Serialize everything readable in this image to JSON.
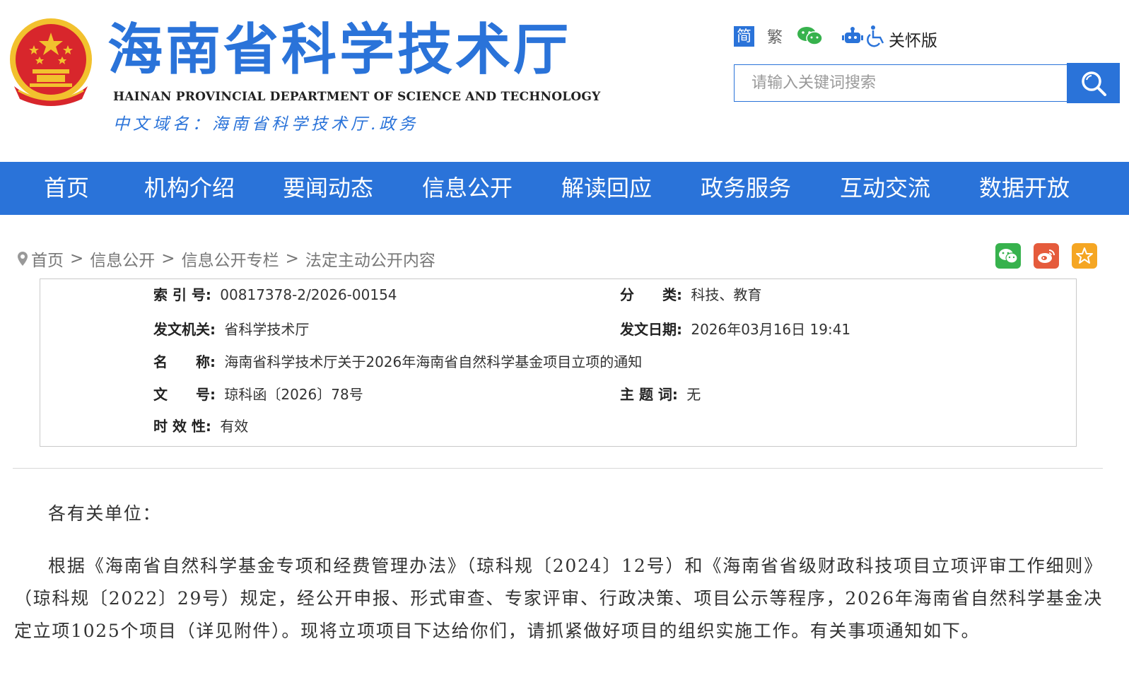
{
  "header": {
    "title": "海南省科学技术厅",
    "title_en": "HAINAN PROVINCIAL DEPARTMENT OF SCIENCE AND TECHNOLOGY",
    "domain": "中文域名：海南省科学技术厅.政务",
    "emblem_icon": "national-emblem-icon"
  },
  "tools": {
    "lang_simple": "简",
    "lang_traditional": "繁",
    "wechat_icon": "wechat-icon",
    "robot_icon": "robot-icon",
    "accessibility_icon": "wheelchair-icon",
    "care_label": "关怀版"
  },
  "search": {
    "placeholder": "请输入关键词搜索",
    "button_icon": "search-icon"
  },
  "nav": {
    "items": [
      {
        "label": "首页"
      },
      {
        "label": "机构介绍"
      },
      {
        "label": "要闻动态"
      },
      {
        "label": "信息公开"
      },
      {
        "label": "解读回应"
      },
      {
        "label": "政务服务"
      },
      {
        "label": "互动交流"
      },
      {
        "label": "数据开放"
      }
    ]
  },
  "breadcrumb": {
    "icon": "location-pin-icon",
    "items": [
      "首页",
      "信息公开",
      "信息公开专栏",
      "法定主动公开内容"
    ],
    "separator": ">"
  },
  "share": {
    "wechat": "wechat-share-icon",
    "weibo": "weibo-share-icon",
    "favorite": "star-favorite-icon"
  },
  "info": {
    "index_label": "索 引 号:",
    "index_value": "00817378-2/2026-00154",
    "category_label": "分　　类:",
    "category_value": "科技、教育",
    "issuer_label": "发文机关:",
    "issuer_value": "省科学技术厅",
    "date_label": "发文日期:",
    "date_value": "2026年03月16日 19:41",
    "name_label": "名　　称:",
    "name_value": "海南省科学技术厅关于2026年海南省自然科学基金项目立项的通知",
    "docno_label": "文　　号:",
    "docno_value": "琼科函〔2026〕78号",
    "keywords_label": "主 题 词:",
    "keywords_value": "无",
    "validity_label": "时 效 性:",
    "validity_value": "有效"
  },
  "content": {
    "greeting": "各有关单位：",
    "paragraph1": "根据《海南省自然科学基金专项和经费管理办法》（琼科规〔2024〕12号）和《海南省省级财政科技项目立项评审工作细则》（琼科规〔2022〕29号）规定，经公开申报、形式审查、专家评审、行政决策、项目公示等程序，2026年海南省自然科学基金决定立项1025个项目（详见附件）。现将立项项目下达给你们，请抓紧做好项目的组织实施工作。有关事项通知如下。"
  },
  "colors": {
    "brand_blue": "#2a73d9",
    "emblem_red": "#d8262c",
    "emblem_gold": "#f2c12e"
  }
}
